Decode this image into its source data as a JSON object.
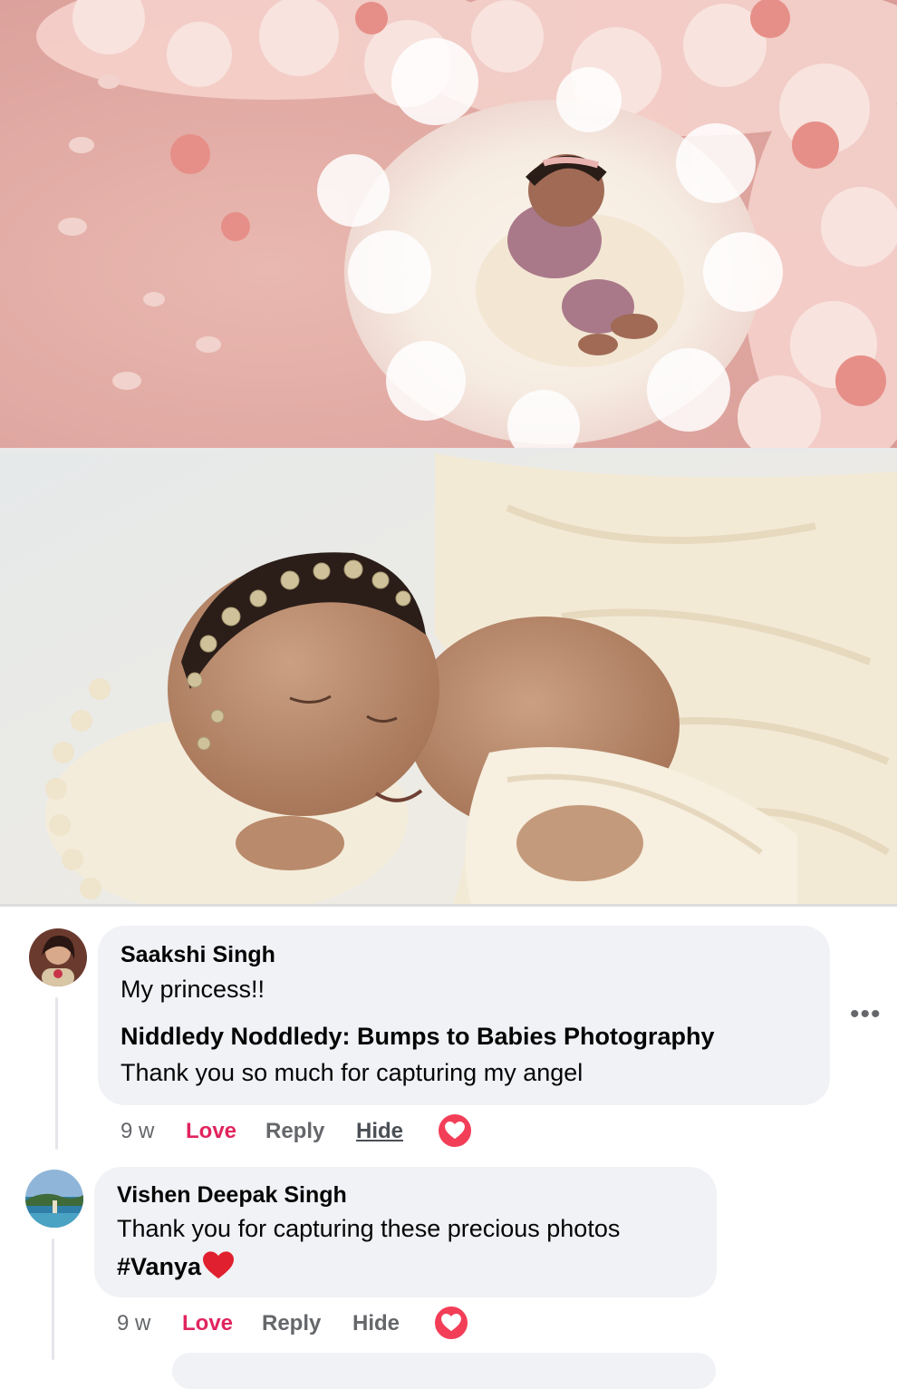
{
  "comments": [
    {
      "author": "Saakshi Singh",
      "text": "My princess!!",
      "reply_author": "Niddledy Noddledy: Bumps to Babies Photography",
      "reply_text": "Thank you so much for capturing my angel",
      "time": "9 w",
      "love_label": "Love",
      "reply_label": "Reply",
      "hide_label": "Hide",
      "reaction": "heart-icon"
    },
    {
      "author": "Vishen Deepak Singh",
      "text": "Thank you for capturing these precious photos",
      "hashtag": "#Vanya",
      "time": "9 w",
      "love_label": "Love",
      "reply_label": "Reply",
      "hide_label": "Hide",
      "reaction": "heart-icon"
    }
  ],
  "more_label": "•••",
  "colors": {
    "love": "#e0245e",
    "bubble": "#f0f2f5",
    "meta": "#65676b",
    "reaction": "#f33e58"
  }
}
